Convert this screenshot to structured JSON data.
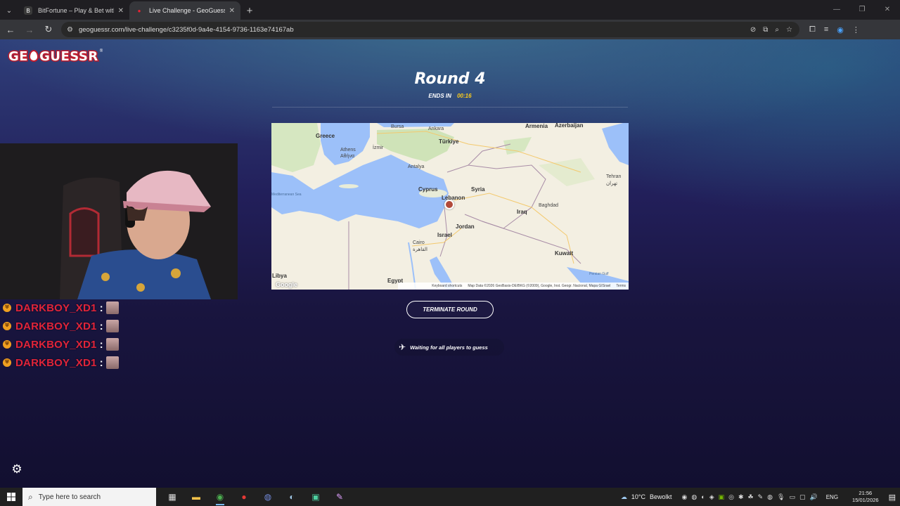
{
  "browser": {
    "tabs": [
      {
        "title": "BitFortune – Play & Bet with Cr",
        "favicon": "B"
      },
      {
        "title": "Live Challenge - GeoGuessr",
        "favicon": "📍"
      }
    ],
    "url": "geoguessr.com/live-challenge/c3235f0d-9a4e-4154-9736-1163e74167ab"
  },
  "page": {
    "logo": {
      "left": "GE",
      "right": "GUESSR",
      "reg": "®"
    },
    "round_title": "Round 4",
    "ends_label": "ENDS IN",
    "ends_time": "00:16",
    "terminate_label": "TERMINATE ROUND",
    "waiting_text": "Waiting for all players to guess"
  },
  "map": {
    "labels": {
      "greece": "Greece",
      "athens": "Athens",
      "athens_gr": "Αθήνα",
      "izmir": "İzmir",
      "bursa": "Bursa",
      "ankara": "Ankara",
      "turkiye": "Türkiye",
      "antalya": "Antalya",
      "armenia": "Armenia",
      "azerbaijan": "Azerbaijan",
      "cyprus": "Cyprus",
      "lebanon": "Lebanon",
      "syria": "Syria",
      "iraq": "Iraq",
      "baghdad": "Baghdad",
      "tehran": "Tehran",
      "tehran_fa": "تهران",
      "israel": "Israel",
      "jordan": "Jordan",
      "cairo": "Cairo",
      "cairo_ar": "القاهرة",
      "kuwait": "Kuwait",
      "egypt": "Egypt",
      "libya": "Libya",
      "med_sea": "Mediterranean Sea",
      "persian_gulf": "Persian Gulf"
    },
    "footer": {
      "shortcuts": "Keyboard shortcuts",
      "attribution": "Map Data ©2026 GeoBasis-DE/BKG (©2009), Google, Inst. Geogr. Nacional, Mapa GISrael",
      "terms": "Terms"
    },
    "google": "Google"
  },
  "chat": [
    {
      "name": "DARKBOY_XD1"
    },
    {
      "name": "DARKBOY_XD1"
    },
    {
      "name": "DARKBOY_XD1"
    },
    {
      "name": "DARKBOY_XD1"
    }
  ],
  "taskbar": {
    "search_placeholder": "Type here to search",
    "temperature": "10°C",
    "weather": "Bewolkt",
    "lang": "ENG",
    "time": "21:56",
    "date": "15/01/2026"
  },
  "colors": {
    "accent_timer": "#fecd19",
    "chat_name": "#e0243a",
    "logo_red": "#c21b2c"
  }
}
